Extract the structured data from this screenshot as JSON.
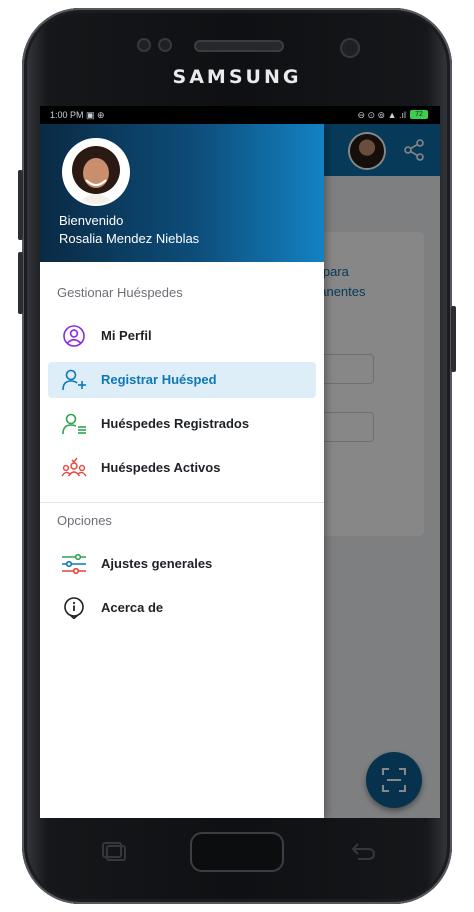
{
  "device": {
    "brand": "SAMSUNG"
  },
  "status_bar": {
    "left_text": "1:00 PM ▣ ⊕",
    "right_text": "⊖ ⊙ ⊚ ▲ .ıl",
    "battery": "72"
  },
  "drawer": {
    "header": {
      "greeting": "Bienvenido",
      "user_name": "Rosalia Mendez Nieblas"
    },
    "sections": [
      {
        "title": "Gestionar Huéspedes",
        "items": [
          {
            "label": "Mi Perfil",
            "icon": "user-circle-icon",
            "color": "#8a2be2"
          },
          {
            "label": "Registrar Huésped",
            "icon": "user-add-icon",
            "color": "#0e78b5",
            "selected": true
          },
          {
            "label": "Huéspedes Registrados",
            "icon": "user-list-icon",
            "color": "#2ea44f"
          },
          {
            "label": "Huéspedes Activos",
            "icon": "group-icon",
            "color": "#e8433a"
          }
        ]
      },
      {
        "title": "Opciones",
        "items": [
          {
            "label": "Ajustes generales",
            "icon": "sliders-icon",
            "color": "#2ea44f"
          },
          {
            "label": "Acerca de",
            "icon": "info-icon",
            "color": "#1e2227"
          }
        ]
      }
    ]
  },
  "background_app": {
    "visible_text_line1": "a para",
    "visible_text_line2": "nanentes"
  },
  "colors": {
    "primary": "#0e6fa8",
    "header_dark": "#0a2a44",
    "selected_bg": "#deeef8"
  }
}
